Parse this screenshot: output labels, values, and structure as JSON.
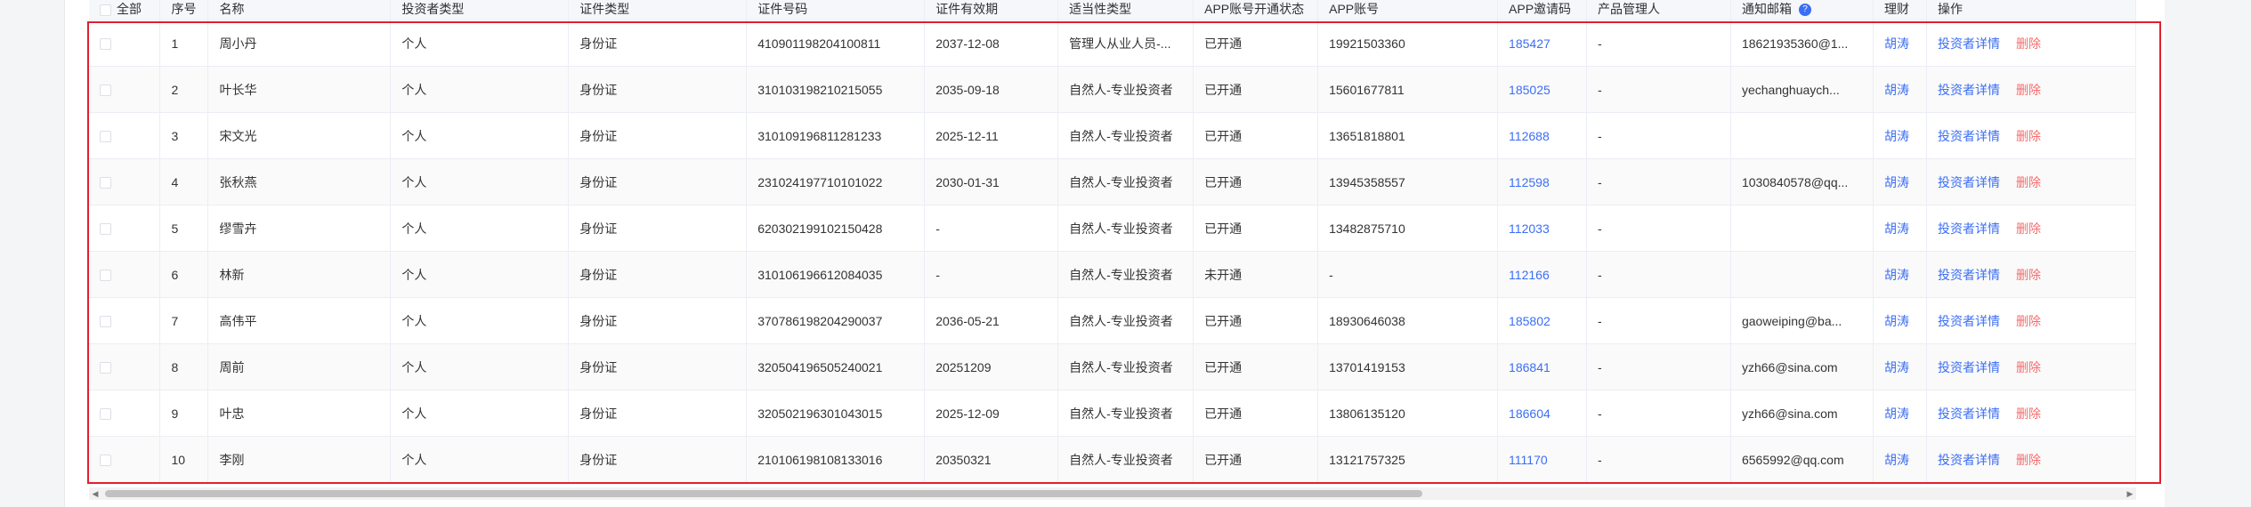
{
  "header": {
    "select_all": "全部",
    "columns": [
      "序号",
      "名称",
      "投资者类型",
      "证件类型",
      "证件号码",
      "证件有效期",
      "适当性类型",
      "APP账号开通状态",
      "APP账号",
      "APP邀请码",
      "产品管理人",
      "通知邮箱",
      "理财",
      "操作"
    ]
  },
  "rows": [
    {
      "seq": "1",
      "name": "周小丹",
      "inv_type": "个人",
      "id_type": "身份证",
      "id_no": "410901198204100811",
      "expire": "2037-12-08",
      "suit": "管理人从业人员-...",
      "app_status": "已开通",
      "app_acct": "19921503360",
      "invite": "185427",
      "manager": "-",
      "email": "18621935360@1...",
      "fin": "胡涛",
      "detail": "投资者详情",
      "del": "删除"
    },
    {
      "seq": "2",
      "name": "叶长华",
      "inv_type": "个人",
      "id_type": "身份证",
      "id_no": "310103198210215055",
      "expire": "2035-09-18",
      "suit": "自然人-专业投资者",
      "app_status": "已开通",
      "app_acct": "15601677811",
      "invite": "185025",
      "manager": "-",
      "email": "yechanghuaych...",
      "fin": "胡涛",
      "detail": "投资者详情",
      "del": "删除"
    },
    {
      "seq": "3",
      "name": "宋文光",
      "inv_type": "个人",
      "id_type": "身份证",
      "id_no": "310109196811281233",
      "expire": "2025-12-11",
      "suit": "自然人-专业投资者",
      "app_status": "已开通",
      "app_acct": "13651818801",
      "invite": "112688",
      "manager": "-",
      "email": "",
      "fin": "胡涛",
      "detail": "投资者详情",
      "del": "删除"
    },
    {
      "seq": "4",
      "name": "张秋燕",
      "inv_type": "个人",
      "id_type": "身份证",
      "id_no": "231024197710101022",
      "expire": "2030-01-31",
      "suit": "自然人-专业投资者",
      "app_status": "已开通",
      "app_acct": "13945358557",
      "invite": "112598",
      "manager": "-",
      "email": "1030840578@qq...",
      "fin": "胡涛",
      "detail": "投资者详情",
      "del": "删除"
    },
    {
      "seq": "5",
      "name": "缪雪卉",
      "inv_type": "个人",
      "id_type": "身份证",
      "id_no": "620302199102150428",
      "expire": "-",
      "suit": "自然人-专业投资者",
      "app_status": "已开通",
      "app_acct": "13482875710",
      "invite": "112033",
      "manager": "-",
      "email": "",
      "fin": "胡涛",
      "detail": "投资者详情",
      "del": "删除"
    },
    {
      "seq": "6",
      "name": "林新",
      "inv_type": "个人",
      "id_type": "身份证",
      "id_no": "310106196612084035",
      "expire": "-",
      "suit": "自然人-专业投资者",
      "app_status": "未开通",
      "app_acct": "-",
      "invite": "112166",
      "manager": "-",
      "email": "",
      "fin": "胡涛",
      "detail": "投资者详情",
      "del": "删除"
    },
    {
      "seq": "7",
      "name": "高伟平",
      "inv_type": "个人",
      "id_type": "身份证",
      "id_no": "370786198204290037",
      "expire": "2036-05-21",
      "suit": "自然人-专业投资者",
      "app_status": "已开通",
      "app_acct": "18930646038",
      "invite": "185802",
      "manager": "-",
      "email": "gaoweiping@ba...",
      "fin": "胡涛",
      "detail": "投资者详情",
      "del": "删除"
    },
    {
      "seq": "8",
      "name": "周前",
      "inv_type": "个人",
      "id_type": "身份证",
      "id_no": "320504196505240021",
      "expire": "20251209",
      "suit": "自然人-专业投资者",
      "app_status": "已开通",
      "app_acct": "13701419153",
      "invite": "186841",
      "manager": "-",
      "email": "yzh66@sina.com",
      "fin": "胡涛",
      "detail": "投资者详情",
      "del": "删除"
    },
    {
      "seq": "9",
      "name": "叶忠",
      "inv_type": "个人",
      "id_type": "身份证",
      "id_no": "320502196301043015",
      "expire": "2025-12-09",
      "suit": "自然人-专业投资者",
      "app_status": "已开通",
      "app_acct": "13806135120",
      "invite": "186604",
      "manager": "-",
      "email": "yzh66@sina.com",
      "fin": "胡涛",
      "detail": "投资者详情",
      "del": "删除"
    },
    {
      "seq": "10",
      "name": "李刚",
      "inv_type": "个人",
      "id_type": "身份证",
      "id_no": "210106198108133016",
      "expire": "20350321",
      "suit": "自然人-专业投资者",
      "app_status": "已开通",
      "app_acct": "13121757325",
      "invite": "111170",
      "manager": "-",
      "email": "6565992@qq.com",
      "fin": "胡涛",
      "detail": "投资者详情",
      "del": "删除"
    }
  ],
  "colors": {
    "link": "#3b6ef5",
    "danger": "#f56c6c",
    "highlight_border": "#e0202f"
  },
  "icons": {
    "help": "question-circle-icon",
    "scroll_left": "caret-left-icon",
    "scroll_right": "caret-right-icon"
  },
  "help_glyph": "?",
  "scroll_left_glyph": "◀",
  "scroll_right_glyph": "▶"
}
